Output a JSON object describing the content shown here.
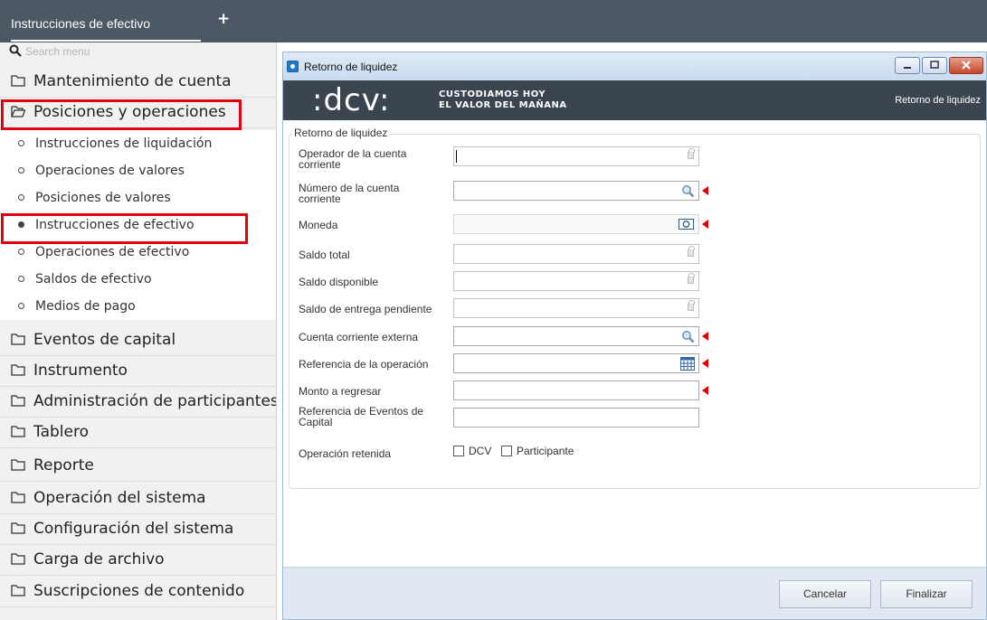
{
  "top_tab": {
    "label": "Instrucciones de efectivo",
    "add": "+"
  },
  "sidebar": {
    "search_placeholder": "Search menu",
    "menu": [
      {
        "label": "Mantenimiento de cuenta"
      },
      {
        "label": "Posiciones y operaciones",
        "open": true,
        "highlighted": true
      },
      {
        "label": "Eventos de capital"
      },
      {
        "label": "Instrumento"
      },
      {
        "label": "Administración de participantes"
      },
      {
        "label": "Tablero"
      },
      {
        "label": "Reporte"
      },
      {
        "label": "Operación del sistema"
      },
      {
        "label": "Configuración del sistema"
      },
      {
        "label": "Carga de archivo"
      },
      {
        "label": "Suscripciones de contenido"
      }
    ],
    "submenu": [
      {
        "label": "Instrucciones de liquidación"
      },
      {
        "label": "Operaciones de valores"
      },
      {
        "label": "Posiciones de valores"
      },
      {
        "label": "Instrucciones de efectivo",
        "selected": true,
        "highlighted": true
      },
      {
        "label": "Operaciones de efectivo"
      },
      {
        "label": "Saldos de efectivo"
      },
      {
        "label": "Medios de pago"
      }
    ]
  },
  "window": {
    "title": "Retorno de liquidez",
    "banner": {
      "logo": ":dcv:",
      "slogan_line1": "CUSTODIAMOS HOY",
      "slogan_line2": "EL VALOR DEL MAÑANA",
      "right_text": "Retorno de liquidez"
    },
    "form": {
      "legend": "Retorno de liquidez",
      "fields": [
        {
          "label": "Operador de la cuenta corriente",
          "value": "",
          "icon": "lock-icon",
          "required": false
        },
        {
          "label": "Número de la cuenta corriente",
          "value": "",
          "icon": "search-icon",
          "required": true
        },
        {
          "label": "Moneda",
          "value": "",
          "icon": "currency-icon",
          "required": true
        },
        {
          "label": "Saldo total",
          "value": "",
          "icon": "lock-icon",
          "required": false
        },
        {
          "label": "Saldo disponible",
          "value": "",
          "icon": "lock-icon",
          "required": false
        },
        {
          "label": "Saldo de entrega pendiente",
          "value": "",
          "icon": "lock-icon",
          "required": false
        },
        {
          "label": "Cuenta corriente externa",
          "value": "",
          "icon": "search-icon",
          "required": true
        },
        {
          "label": "Referencia de la operación",
          "value": "",
          "icon": "calendar-icon",
          "required": true
        },
        {
          "label": "Monto a regresar",
          "value": "",
          "icon": "",
          "required": true
        },
        {
          "label": "Referencia de Eventos de Capital",
          "value": "",
          "icon": "",
          "required": false
        }
      ],
      "retained": {
        "label": "Operación retenida",
        "options": [
          {
            "label": "DCV",
            "checked": false
          },
          {
            "label": "Participante",
            "checked": false
          }
        ]
      }
    },
    "footer": {
      "cancel": "Cancelar",
      "finish": "Finalizar"
    }
  },
  "colors": {
    "highlight": "#e1000f",
    "banner": "#3a4550",
    "topbar": "#4c5863",
    "required_marker": "#e00000"
  }
}
